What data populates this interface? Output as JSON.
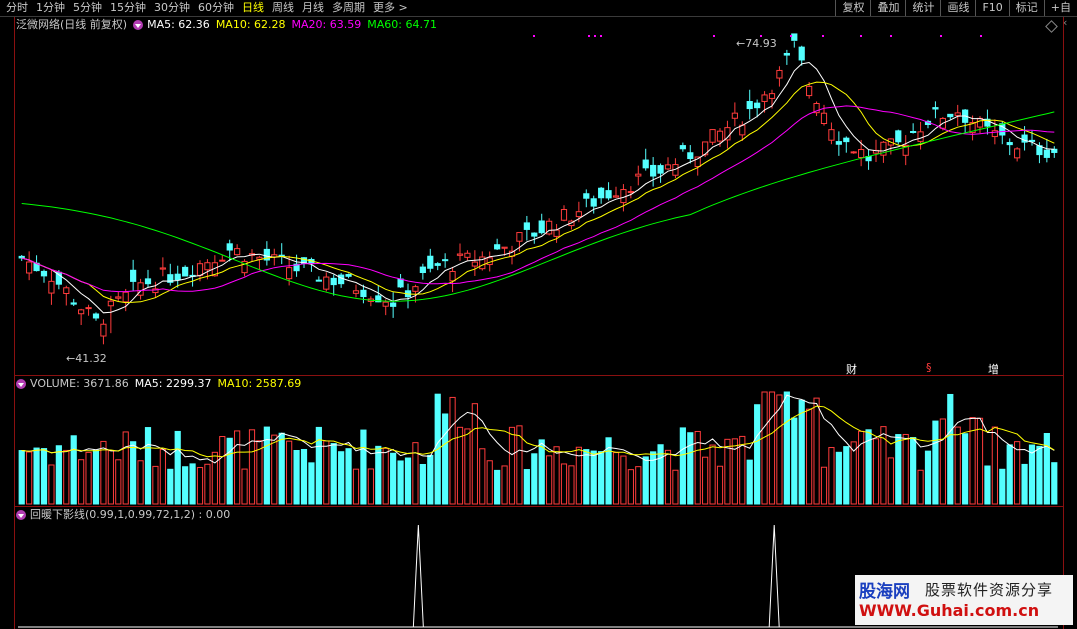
{
  "toolbar": {
    "periods": [
      "分时",
      "1分钟",
      "5分钟",
      "15分钟",
      "30分钟",
      "60分钟",
      "日线",
      "周线",
      "月线",
      "多周期",
      "更多 >"
    ],
    "active_period": "日线",
    "tools": [
      "复权",
      "叠加",
      "统计",
      "画线",
      "F10",
      "标记",
      "+自"
    ]
  },
  "main_pane": {
    "title": "泛微网络(日线 前复权)",
    "ma5": "MA5: 62.36",
    "ma10": "MA10: 62.28",
    "ma20": "MA20: 63.59",
    "ma60": "MA60: 64.71",
    "high_label": "74.93",
    "low_label": "41.32",
    "event_markers": [
      "财",
      "§",
      "增"
    ]
  },
  "volume_pane": {
    "title": "VOLUME: 3671.86",
    "ma5": "MA5: 2299.37",
    "ma10": "MA10: 2587.69"
  },
  "indicator_pane": {
    "title": "回暖下影线(0.99,1,0.99,72,1,2) : 0.00"
  },
  "watermark": {
    "name": "股海网",
    "slogan": "股票软件资源分享",
    "url": "WWW.Guhai.com.cn"
  },
  "colors": {
    "up": "#ff3c3c",
    "down": "#54ffff",
    "ma5": "#ffffff",
    "ma10": "#ffff00",
    "ma20": "#ff00ff",
    "ma60": "#00ff00",
    "frame": "#8a1010"
  },
  "chart_data": {
    "type": "candlestick",
    "price_range": [
      41.32,
      74.93
    ],
    "days": 140,
    "high": 74.93,
    "low": 41.32,
    "indicator_spikes": 2
  }
}
